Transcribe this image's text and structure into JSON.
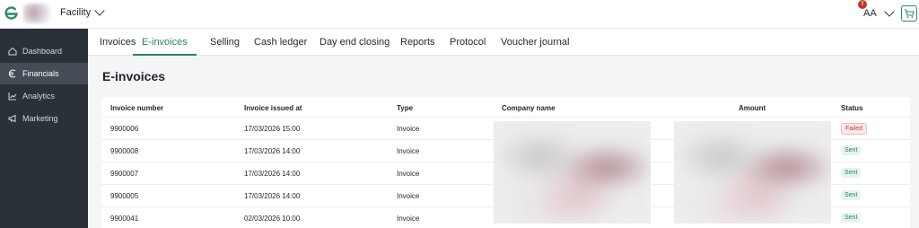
{
  "header": {
    "facility_label": "Facility",
    "user_initials": "AA",
    "notification_count": "!"
  },
  "sidebar": {
    "items": [
      {
        "label": "Dashboard",
        "icon": "home-icon"
      },
      {
        "label": "Financials",
        "icon": "euro-icon",
        "active": true
      },
      {
        "label": "Analytics",
        "icon": "chart-icon"
      },
      {
        "label": "Marketing",
        "icon": "megaphone-icon"
      }
    ]
  },
  "tabs": [
    {
      "label": "Invoices"
    },
    {
      "label": "E-invoices",
      "active": true
    },
    {
      "label": "Selling"
    },
    {
      "label": "Cash ledger"
    },
    {
      "label": "Day end closing"
    },
    {
      "label": "Reports"
    },
    {
      "label": "Protocol"
    },
    {
      "label": "Voucher journal"
    }
  ],
  "page": {
    "title": "E-invoices"
  },
  "table": {
    "columns": [
      "Invoice number",
      "Invoice issued at",
      "Type",
      "Company name",
      "Amount",
      "Status"
    ],
    "rows": [
      {
        "number": "9900006",
        "issued": "17/03/2026 15:00",
        "type": "Invoice",
        "status": "Failed"
      },
      {
        "number": "9900008",
        "issued": "17/03/2026 14:00",
        "type": "Invoice",
        "status": "Sent"
      },
      {
        "number": "9900007",
        "issued": "17/03/2026 14:00",
        "type": "Invoice",
        "status": "Sent"
      },
      {
        "number": "9900005",
        "issued": "17/03/2026 14:00",
        "type": "Invoice",
        "status": "Sent"
      },
      {
        "number": "9900041",
        "issued": "02/03/2026 10:00",
        "type": "Invoice",
        "status": "Sent"
      }
    ]
  },
  "colors": {
    "accent": "#2d7d68",
    "sidebar_bg": "#2b3138",
    "failed": "#b54040",
    "sent": "#2d7d68"
  }
}
